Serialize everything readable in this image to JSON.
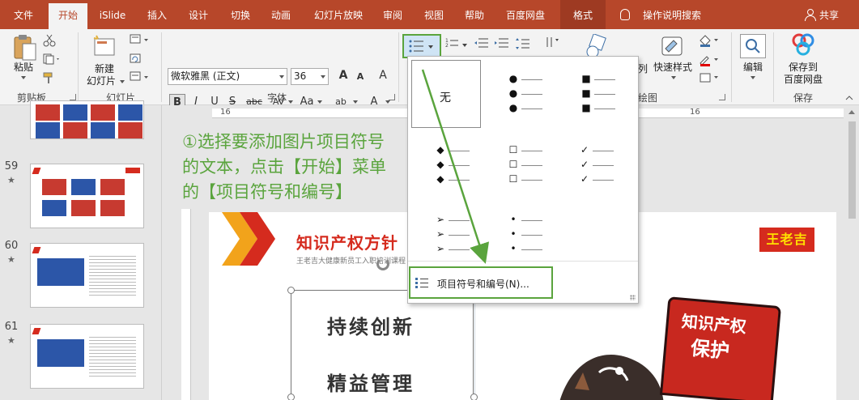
{
  "tabs": {
    "file": "文件",
    "home": "开始",
    "islide": "iSlide",
    "insert": "插入",
    "design": "设计",
    "transitions": "切换",
    "animations": "动画",
    "slideshow": "幻灯片放映",
    "review": "审阅",
    "view": "视图",
    "help": "帮助",
    "baidu": "百度网盘",
    "format": "格式",
    "tell_me": "操作说明搜索",
    "share": "共享"
  },
  "ribbon": {
    "paste": "粘贴",
    "clipboard": "剪贴板",
    "new_slide_line1": "新建",
    "new_slide_line2": "幻灯片",
    "slides": "幻灯片",
    "font_name": "微软雅黑 (正文)",
    "font_size": "36",
    "font_group": "字体",
    "bold": "B",
    "italic": "I",
    "underline": "U",
    "strike": "S",
    "abc": "abc",
    "char_spacing": "AV",
    "change_case": "Aa",
    "grow_font": "A",
    "shrink_font": "A",
    "clear_format": "A",
    "font_color_sample": "A",
    "highlight_sample": "ab",
    "arrange_fragment": "列",
    "quick_styles": "快速样式",
    "drawing_fragment": "绘图",
    "edit": "编辑",
    "save_baidu_line1": "保存到",
    "save_baidu_line2": "百度网盘",
    "save": "保存"
  },
  "ruler": {
    "label_left": "16",
    "label_right": "16"
  },
  "slides_panel": [
    {
      "number": "",
      "star": ""
    },
    {
      "number": "59",
      "star": "★"
    },
    {
      "number": "60",
      "star": "★"
    },
    {
      "number": "61",
      "star": "★"
    }
  ],
  "annotation": {
    "line1": "①选择要添加图片项目符号",
    "line2": "的文本，点击【开始】菜单",
    "line3": "的【项目符号和编号】"
  },
  "slide": {
    "title": "知识产权方针",
    "subtitle": "王老吉大健康新员工入职培训课程",
    "stamp": "王老吉",
    "line1": "持续创新",
    "line2": "精益管理",
    "book_line1": "知识产权",
    "book_line2": "保护"
  },
  "bullet_menu": {
    "none_label": "无",
    "options": [
      {
        "name": "filled-round",
        "symbol": "●"
      },
      {
        "name": "filled-square",
        "symbol": "■"
      },
      {
        "name": "diamond",
        "symbol": "◆"
      },
      {
        "name": "hollow-square",
        "symbol": "☐"
      },
      {
        "name": "checkmark",
        "symbol": "✓"
      },
      {
        "name": "arrow",
        "symbol": "➢"
      },
      {
        "name": "small-dot",
        "symbol": "•"
      }
    ],
    "bullets_numbering_item": "项目符号和编号(N)..."
  },
  "colors": {
    "ribbon_red": "#b7472a",
    "annotation_green": "#5aa43d",
    "brand_red": "#d52b1e",
    "stamp_yellow": "#ffe000"
  }
}
